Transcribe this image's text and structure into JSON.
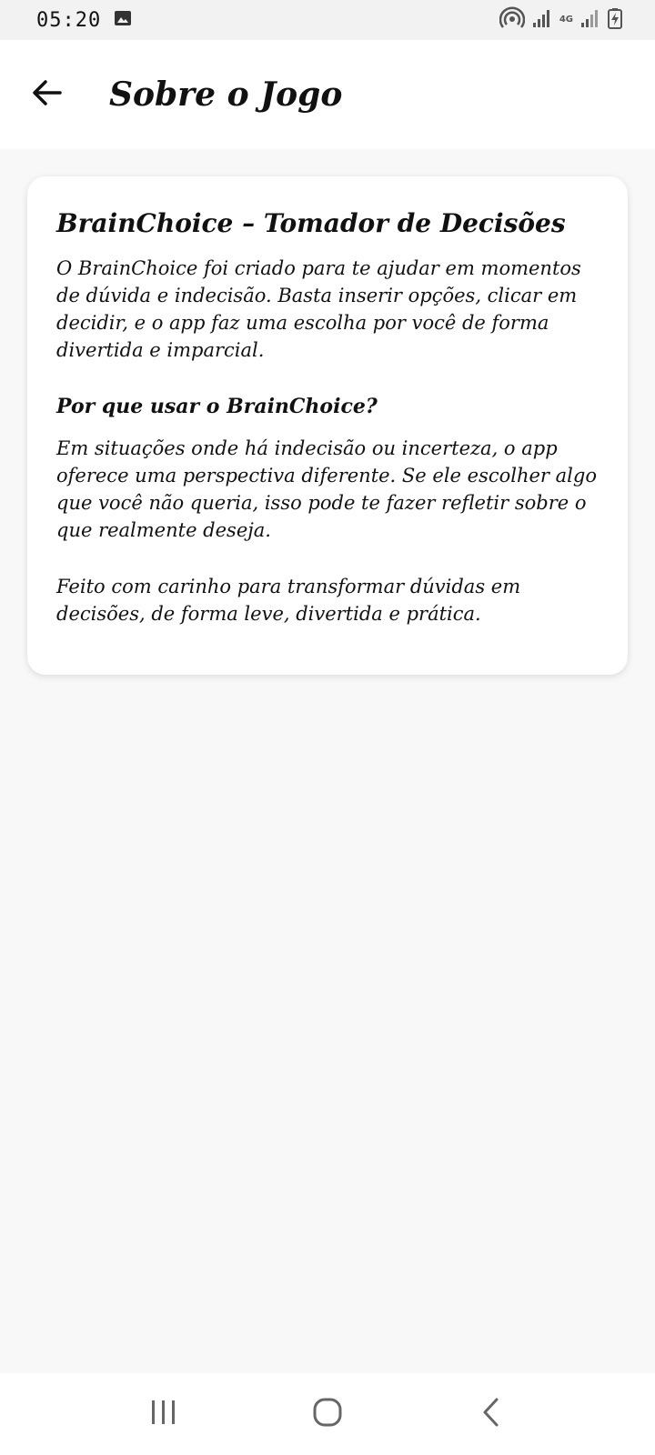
{
  "status_bar": {
    "time": "05:20",
    "network_label": "4G"
  },
  "app_bar": {
    "title": "Sobre o Jogo"
  },
  "card": {
    "title": "BrainChoice – Tomador de Decisões",
    "intro": "O BrainChoice foi criado para te ajudar em momentos de dúvida e indecisão. Basta inserir opções, clicar em decidir, e o app faz uma escolha por você de forma divertida e imparcial.",
    "subtitle": "Por que usar o BrainChoice?",
    "reason": "Em situações onde há indecisão ou incerteza, o app oferece uma perspectiva diferente. Se ele escolher algo que você não queria, isso pode te fazer refletir sobre o que realmente deseja.",
    "closing": "Feito com carinho para transformar dúvidas em decisões, de forma leve, divertida e prática."
  },
  "icons": {
    "back": "arrow-left-icon",
    "recents": "recent-apps-icon",
    "home": "home-icon",
    "nav_back": "chevron-left-icon"
  }
}
